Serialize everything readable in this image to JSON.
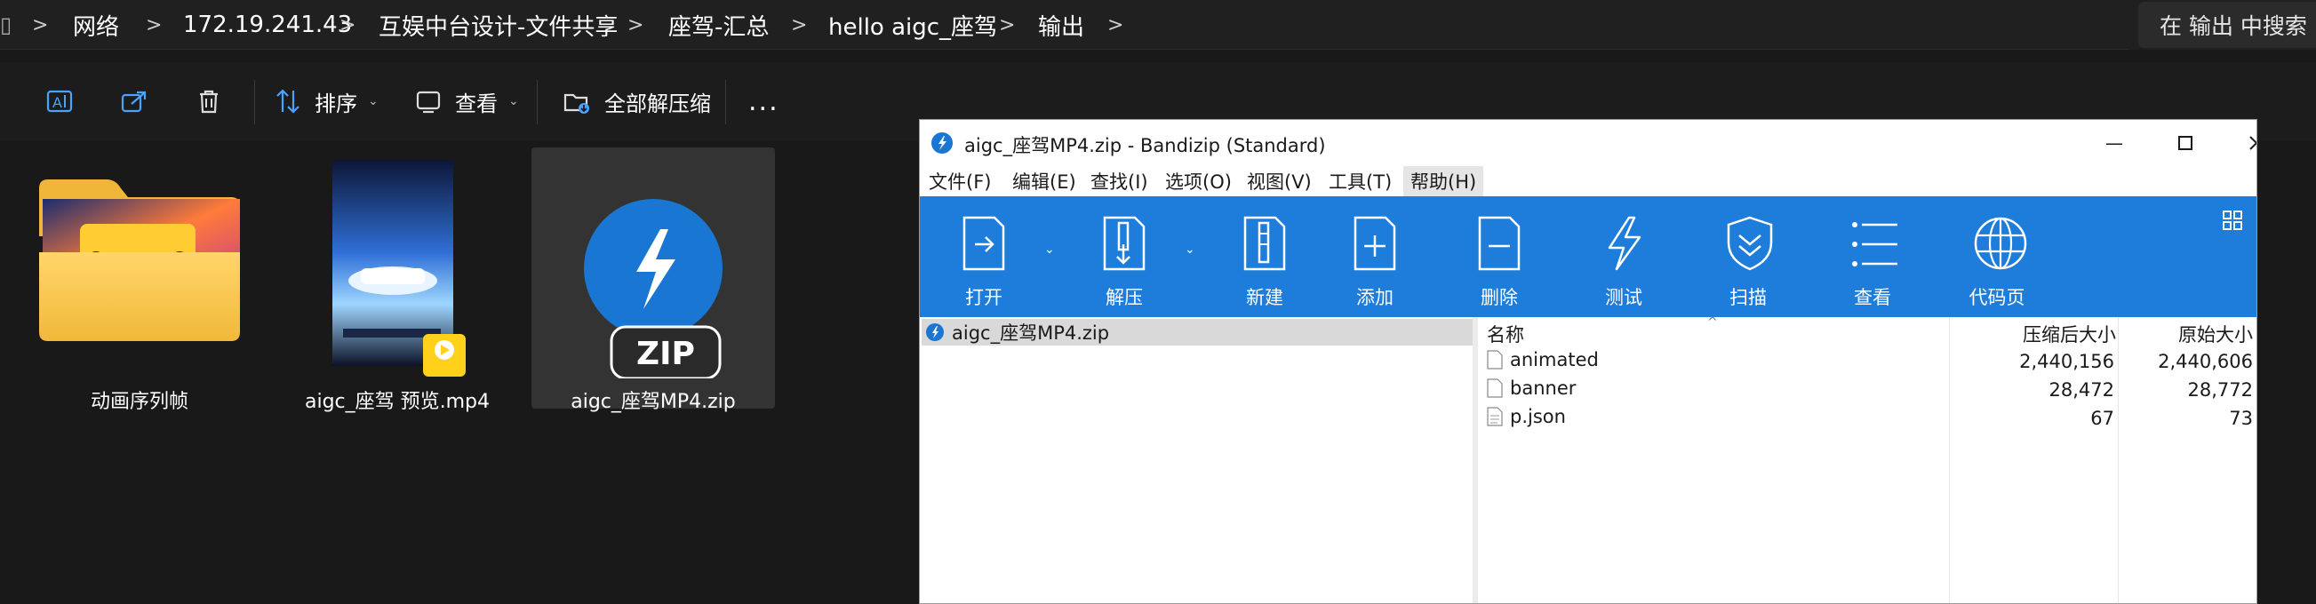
{
  "explorer": {
    "breadcrumb": [
      "网络",
      "172.19.241.43",
      "互娱中台设计-文件共享",
      "座驾-汇总",
      "hello aigc_座驾",
      "输出"
    ],
    "search_placeholder": "在 输出 中搜索",
    "commands": {
      "sort_label": "排序",
      "view_label": "查看",
      "extract_all_label": "全部解压缩",
      "more_label": "..."
    },
    "files": [
      {
        "name": "动画序列帧",
        "type": "folder"
      },
      {
        "name": "aigc_座驾 预览.mp4",
        "type": "video",
        "badge": "Player"
      },
      {
        "name": "aigc_座驾MP4.zip",
        "type": "zip",
        "badge": "ZIP",
        "selected": true
      }
    ]
  },
  "bandizip": {
    "title": "aigc_座驾MP4.zip - Bandizip (Standard)",
    "menu": [
      "文件(F)",
      "编辑(E)",
      "查找(I)",
      "选项(O)",
      "视图(V)",
      "工具(T)",
      "帮助(H)"
    ],
    "toolbar": [
      "打开",
      "解压",
      "新建",
      "添加",
      "删除",
      "测试",
      "扫描",
      "查看",
      "代码页"
    ],
    "tree_root": "aigc_座驾MP4.zip",
    "columns": {
      "name": "名称",
      "compressed": "压缩后大小",
      "original": "原始大小"
    },
    "files": [
      {
        "name": "animated",
        "compressed": "2,440,156",
        "original": "2,440,606"
      },
      {
        "name": "banner",
        "compressed": "28,472",
        "original": "28,772"
      },
      {
        "name": "p.json",
        "compressed": "67",
        "original": "73"
      }
    ],
    "colors": {
      "toolbar": "#1e7ddb",
      "accent": "#1976d2"
    }
  }
}
